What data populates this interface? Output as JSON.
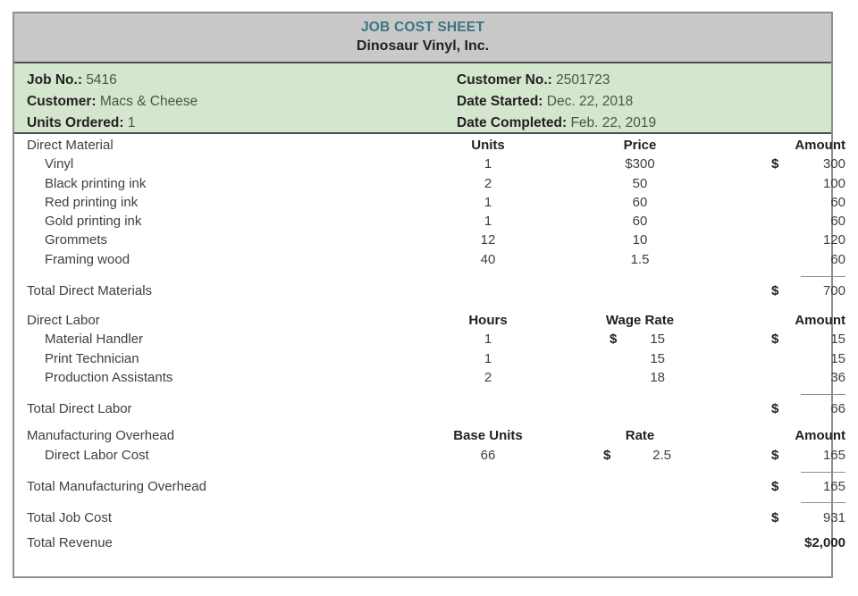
{
  "header": {
    "title": "JOB COST SHEET",
    "company": "Dinosaur Vinyl, Inc.",
    "title_color": "#3a7580",
    "band_color": "#c9c9c9"
  },
  "info": {
    "band_color": "#d4e6ce",
    "left": [
      {
        "label": "Job No.:",
        "value": "5416"
      },
      {
        "label": "Customer:",
        "value": "Macs & Cheese"
      },
      {
        "label": "Units Ordered:",
        "value": "1"
      }
    ],
    "right": [
      {
        "label": "Customer No.:",
        "value": "2501723"
      },
      {
        "label": "Date Started:",
        "value": "Dec. 22, 2018"
      },
      {
        "label": "Date Completed:",
        "value": "Feb. 22, 2019"
      }
    ]
  },
  "direct_material": {
    "section_label": "Direct Material",
    "columns": {
      "units": "Units",
      "price": "Price",
      "amount": "Amount"
    },
    "items": [
      {
        "name": "Vinyl",
        "units": "1",
        "price": "$300",
        "price_cur": "$",
        "price_num": "300",
        "amount_cur": "$",
        "amount": "300"
      },
      {
        "name": "Black printing ink",
        "units": "2",
        "price": "50",
        "price_cur": "",
        "price_num": "50",
        "amount_cur": "",
        "amount": "100"
      },
      {
        "name": "Red printing ink",
        "units": "1",
        "price": "60",
        "price_cur": "",
        "price_num": "60",
        "amount_cur": "",
        "amount": "60"
      },
      {
        "name": "Gold printing ink",
        "units": "1",
        "price": "60",
        "price_cur": "",
        "price_num": "60",
        "amount_cur": "",
        "amount": "60"
      },
      {
        "name": "Grommets",
        "units": "12",
        "price": "10",
        "price_cur": "",
        "price_num": "10",
        "amount_cur": "",
        "amount": "120"
      },
      {
        "name": "Framing wood",
        "units": "40",
        "price": "1.5",
        "price_cur": "",
        "price_num": "1.5",
        "amount_cur": "",
        "amount": "60"
      }
    ],
    "total_label": "Total Direct Materials",
    "total_cur": "$",
    "total_amount": "700"
  },
  "direct_labor": {
    "section_label": "Direct Labor",
    "columns": {
      "hours": "Hours",
      "wage_rate": "Wage Rate",
      "amount": "Amount"
    },
    "items": [
      {
        "name": "Material Handler",
        "hours": "1",
        "rate_cur": "$",
        "rate_num": "15",
        "amount_cur": "$",
        "amount": "15"
      },
      {
        "name": "Print Technician",
        "hours": "1",
        "rate_cur": "",
        "rate_num": "15",
        "amount_cur": "",
        "amount": "15"
      },
      {
        "name": "Production Assistants",
        "hours": "2",
        "rate_cur": "",
        "rate_num": "18",
        "amount_cur": "",
        "amount": "36"
      }
    ],
    "total_label": "Total Direct Labor",
    "total_cur": "$",
    "total_amount": "66"
  },
  "manufacturing_overhead": {
    "section_label": "Manufacturing Overhead",
    "columns": {
      "base_units": "Base Units",
      "rate": "Rate",
      "amount": "Amount"
    },
    "items": [
      {
        "name": "Direct Labor Cost",
        "base_units": "66",
        "rate_cur": "$",
        "rate_num": "2.5",
        "amount_cur": "$",
        "amount": "165"
      }
    ],
    "total_label": "Total Manufacturing Overhead",
    "total_cur": "$",
    "total_amount": "165"
  },
  "totals": {
    "job_cost_label": "Total Job Cost",
    "job_cost_cur": "$",
    "job_cost_amount": "931",
    "revenue_label": "Total Revenue",
    "revenue_amount": "$2,000"
  }
}
